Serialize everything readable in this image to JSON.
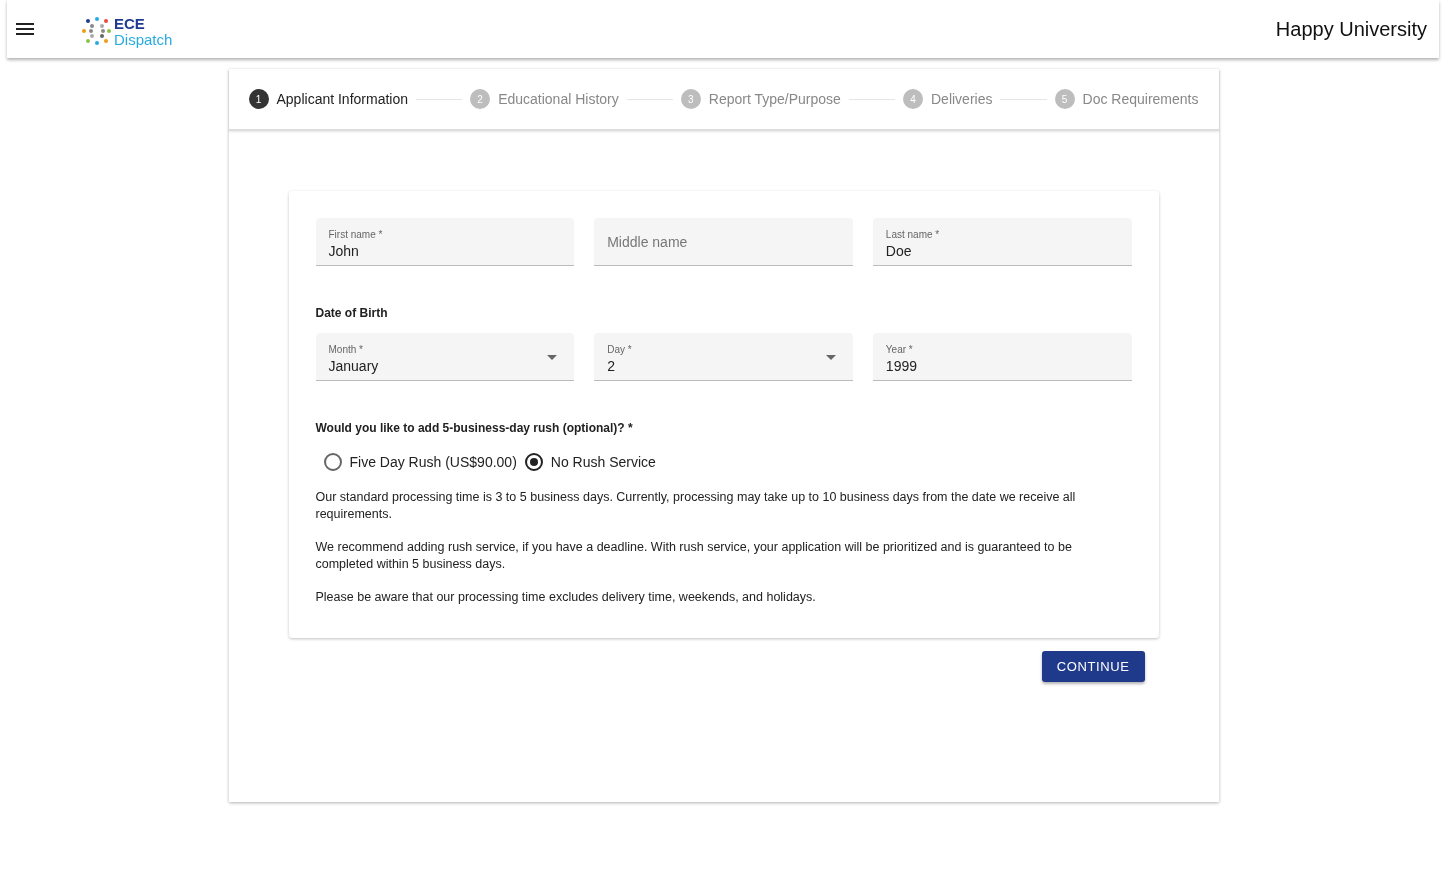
{
  "header": {
    "logo_top": "ECE",
    "logo_bottom": "Dispatch",
    "title": "Happy University"
  },
  "steps": [
    {
      "number": "1",
      "label": "Applicant Information",
      "selected": true
    },
    {
      "number": "2",
      "label": "Educational History",
      "selected": false
    },
    {
      "number": "3",
      "label": "Report Type/Purpose",
      "selected": false
    },
    {
      "number": "4",
      "label": "Deliveries",
      "selected": false
    },
    {
      "number": "5",
      "label": "Doc Requirements",
      "selected": false
    }
  ],
  "name_fields": [
    {
      "label": "First name *",
      "value": "John"
    },
    {
      "placeholder": "Middle name"
    },
    {
      "label": "Last name *",
      "value": "Doe"
    }
  ],
  "dob_heading": "Date of Birth",
  "dob_fields": [
    {
      "kind": "select",
      "label": "Month *",
      "value": "January"
    },
    {
      "kind": "select",
      "label": "Day *",
      "value": "2"
    },
    {
      "kind": "text",
      "label": "Year *",
      "value": "1999"
    }
  ],
  "rush_question": "Would you like to add 5-business-day rush (optional)? *",
  "rush_options": [
    {
      "label": "Five Day Rush (US$90.00)",
      "selected": false
    },
    {
      "label": "No Rush Service",
      "selected": true
    }
  ],
  "paragraphs": [
    "Our standard processing time is 3 to 5 business days. Currently, processing may take up to 10 business days from the date we receive all requirements.",
    "We recommend adding rush service, if you have a deadline. With rush service, your application will be prioritized and is guaranteed to be completed within 5 business days.",
    "Please be aware that our processing time excludes delivery time, weekends, and holidays."
  ],
  "continue_button": "CONTINUE"
}
